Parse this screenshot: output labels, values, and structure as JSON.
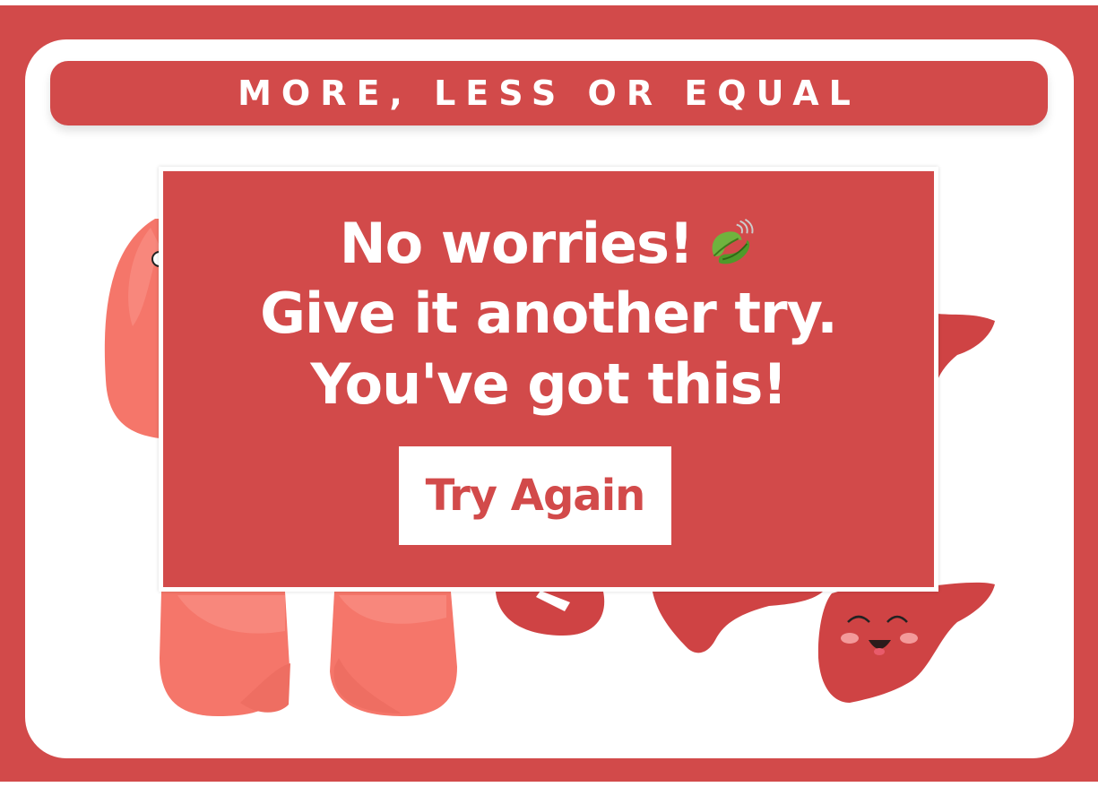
{
  "game": {
    "title": "MORE, LESS OR EQUAL"
  },
  "modal": {
    "line1": "No worries!",
    "line2": "Give it another try.",
    "line3": "You've got this!",
    "icon": "leaf-fluttering-in-wind-icon",
    "button_label": "Try Again"
  },
  "colors": {
    "primary_red": "#d24a4a",
    "lung_salmon": "#f5766a",
    "liver_red": "#cf4344",
    "white": "#ffffff"
  },
  "scene_items": [
    "lung-organ",
    "lung-organ",
    "liver-organ",
    "liver-organ",
    "liver-organ",
    "stomach-organ"
  ]
}
